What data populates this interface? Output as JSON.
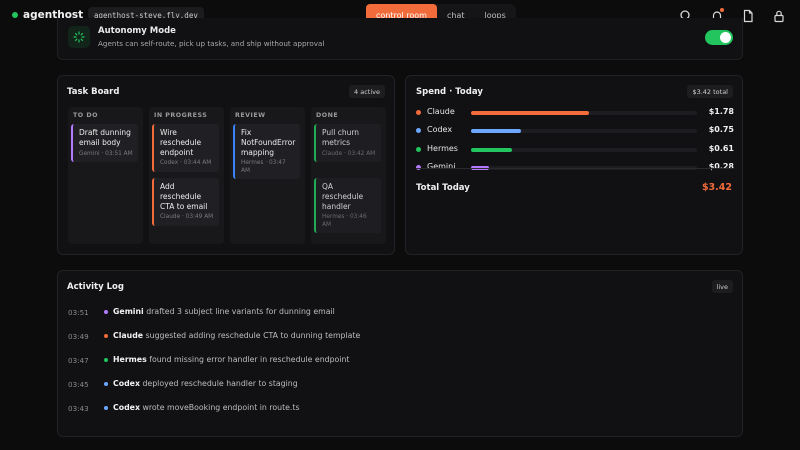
{
  "brand": {
    "name": "agenthost",
    "host": "agenthost-steve.fly.dev"
  },
  "nav": {
    "tabs": [
      {
        "label": "control room"
      },
      {
        "label": "chat"
      },
      {
        "label": "loops"
      }
    ]
  },
  "autonomy": {
    "title": "Autonomy Mode",
    "description": "Agents can self-route, pick up tasks, and ship without approval",
    "enabled": true
  },
  "colors": {
    "accent": "#f26b3a",
    "claude": "#f26b3a",
    "codex": "#6ea8fe",
    "hermes": "#22c55e",
    "gemini": "#b57bff",
    "review": "#3b82f6",
    "done": "#22c55e"
  },
  "task_board": {
    "title": "Task Board",
    "badge": "4 active",
    "columns": [
      {
        "name": "TO DO",
        "cards": [
          {
            "title": "Draft dunning email body",
            "meta": "Gemini · 03:51 AM"
          }
        ]
      },
      {
        "name": "IN PROGRESS",
        "cards": [
          {
            "title": "Wire reschedule endpoint",
            "meta": "Codex · 03:44 AM"
          },
          {
            "title": "Add reschedule CTA to email",
            "meta": "Claude · 03:49 AM"
          }
        ]
      },
      {
        "name": "REVIEW",
        "cards": [
          {
            "title": "Fix NotFoundError mapping",
            "meta": "Hermes · 03:47 AM"
          }
        ]
      },
      {
        "name": "DONE",
        "cards": [
          {
            "title": "Pull churn metrics",
            "meta": "Claude · 03:42 AM"
          },
          {
            "title": "QA reschedule handler",
            "meta": "Hermes · 03:46 AM"
          }
        ]
      }
    ]
  },
  "spend": {
    "title": "Spend · Today",
    "badge": "$3.42 total",
    "rows": [
      {
        "name": "Claude",
        "value": "$1.78",
        "share": 0.52
      },
      {
        "name": "Codex",
        "value": "$0.75",
        "share": 0.22
      },
      {
        "name": "Hermes",
        "value": "$0.61",
        "share": 0.18
      },
      {
        "name": "Gemini",
        "value": "$0.28",
        "share": 0.08
      }
    ],
    "total_label": "Total Today",
    "total_value": "$3.42"
  },
  "activity": {
    "title": "Activity Log",
    "badge": "live",
    "entries": [
      {
        "time": "03:51",
        "agent": "Gemini",
        "text": "drafted 3 subject line variants for dunning email"
      },
      {
        "time": "03:49",
        "agent": "Claude",
        "text": "suggested adding reschedule CTA to dunning template"
      },
      {
        "time": "03:47",
        "agent": "Hermes",
        "text": "found missing error handler in reschedule endpoint"
      },
      {
        "time": "03:45",
        "agent": "Codex",
        "text": "deployed reschedule handler to staging"
      },
      {
        "time": "03:43",
        "agent": "Codex",
        "text": "wrote moveBooking endpoint in route.ts"
      }
    ]
  }
}
